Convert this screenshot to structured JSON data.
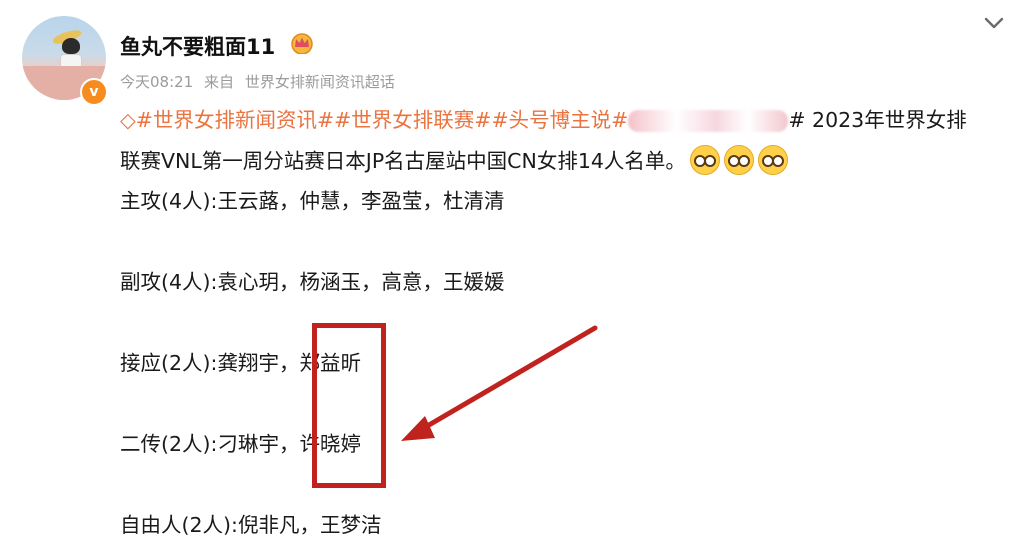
{
  "post": {
    "username": "鱼丸不要粗面11",
    "time": "今天08:21",
    "source_prefix": "来自",
    "source": "世界女排新闻资讯超话",
    "topics": [
      "#世界女排新闻资讯#",
      "#世界女排联赛#",
      "#头号博主说#"
    ],
    "intro_tail": "# 2023年世界女排",
    "intro_line2": "联赛VNL第一周分站赛日本JP名古屋站中国CN女排14人名单。",
    "roster": [
      "主攻(4人):王云蕗，仲慧，李盈莹，杜清清",
      "副攻(4人):袁心玥，杨涵玉，高意，王媛媛",
      "接应(2人):龚翔宇，郑益昕",
      "二传(2人):刁琳宇，许晓婷",
      "自由人(2人):倪非凡，王梦洁"
    ]
  },
  "icons": {
    "verified": "verified-badge-icon",
    "crown": "crown-icon",
    "collapse": "chevron-down-icon",
    "emoji": "emoji-icon",
    "annotation_arrow": "arrow-icon"
  },
  "colors": {
    "topic": "#eb7340",
    "meta": "#9b9b9b",
    "annotation": "#c0221e",
    "verified": "#f78c1e"
  }
}
